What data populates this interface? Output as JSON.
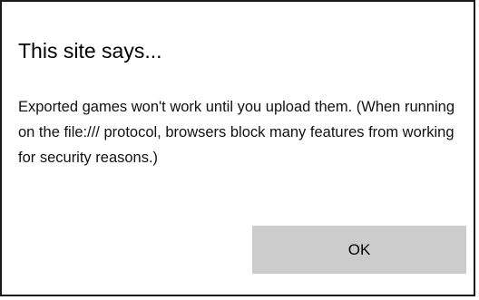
{
  "dialog": {
    "title": "This site says...",
    "message": "Exported games won't work until you upload them. (When running on the file:/// protocol, browsers block many features from working for security reasons.)",
    "ok_label": "OK"
  },
  "colors": {
    "button_background": "#cccccc",
    "border": "#1a1a1a"
  }
}
